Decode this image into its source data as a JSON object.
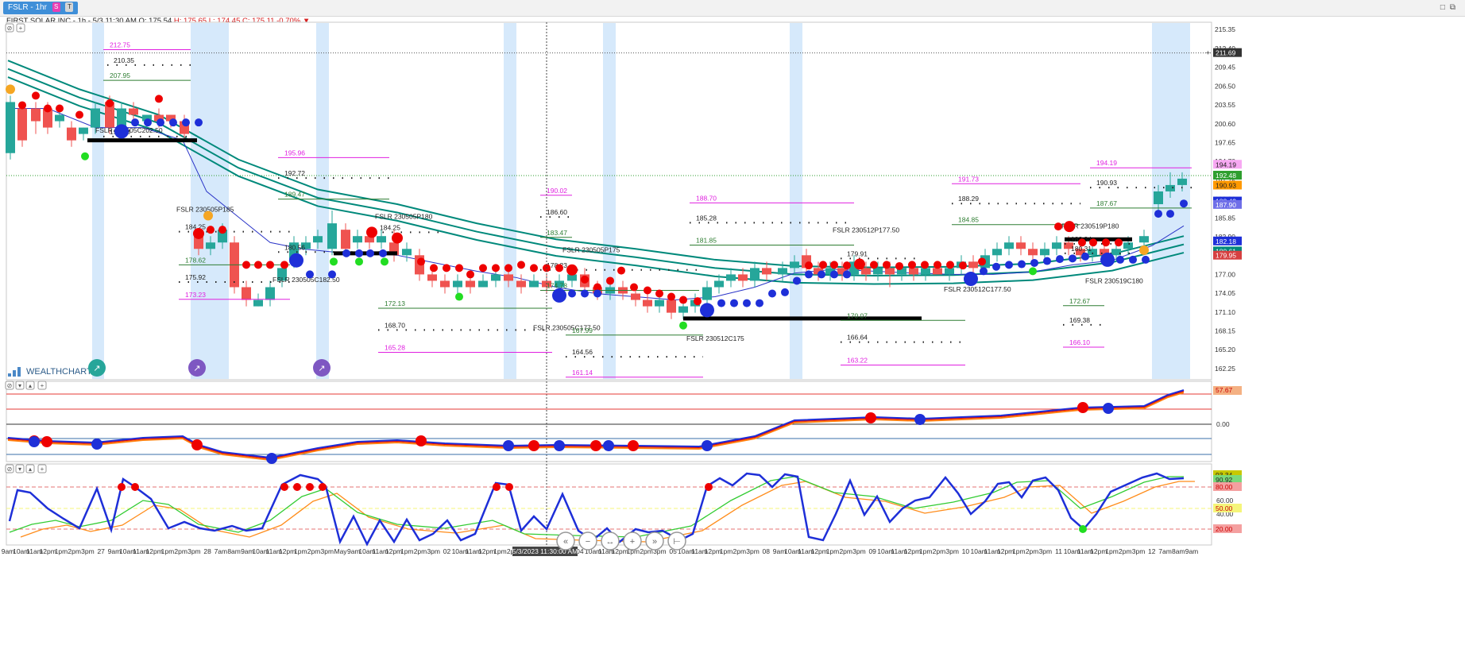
{
  "tab": {
    "label": "FSLR - 1hr",
    "badge_s": "S",
    "badge_t": "T"
  },
  "window_icons": [
    "minimize-icon",
    "restore-icon"
  ],
  "info": {
    "company": "FIRST SOLAR INC",
    "interval": "- 1h -",
    "datetime": "5/3 11:30 AM",
    "open": "O: 175.54",
    "high": "H: 175.65",
    "low": "L: 174.45",
    "close": "C: 175.11",
    "change": "-0.70%"
  },
  "logo": "WEALTHCHARTS",
  "crosshair_time": "5/3/2023 11:30:00 AM",
  "nav_buttons": [
    "«",
    "−",
    "↔",
    "+",
    "»",
    "⊢"
  ],
  "colors": {
    "up": "#26a69a",
    "down": "#ef5350",
    "band": "#00897b",
    "highlight": "#d6e9fb",
    "signal_red": "#ee0000",
    "signal_blue": "#1e2fd8",
    "magenta": "#e020e0",
    "green_line": "#2e7d32"
  },
  "chart_data": [
    {
      "type": "candlestick",
      "title": "FIRST SOLAR INC - 1h",
      "y_ticks": [
        "215.35",
        "212.40",
        "209.45",
        "206.50",
        "203.55",
        "200.60",
        "197.65",
        "194.70",
        "191.75",
        "188.80",
        "185.85",
        "182.90",
        "179.95",
        "177.00",
        "174.05",
        "171.10",
        "168.15",
        "165.20",
        "162.25"
      ],
      "price_labels": [
        "211.69",
        "194.19",
        "192.48",
        "190.93",
        "188.43",
        "187.90",
        "182.18",
        "180.61",
        "179.95"
      ],
      "x_labels": [
        "9am",
        "10am",
        "11am",
        "12pm",
        "1pm",
        "2pm",
        "3pm",
        "27",
        "9am",
        "10am",
        "11am",
        "12pm",
        "1pm",
        "2pm",
        "3pm",
        "28",
        "7am",
        "8am",
        "9am",
        "10am",
        "11am",
        "12pm",
        "1pm",
        "2pm",
        "3pm",
        "May",
        "9am",
        "10am",
        "11am",
        "12pm",
        "1pm",
        "2pm",
        "3pm",
        "02",
        "10am",
        "11am",
        "12pm",
        "1pm",
        "2pm",
        "3pm",
        "03",
        "8am",
        "9am",
        "04",
        "10am",
        "11am",
        "12pm",
        "1pm",
        "2pm",
        "3pm",
        "05",
        "10am",
        "11am",
        "12pm",
        "1pm",
        "2pm",
        "3pm",
        "08",
        "9am",
        "10am",
        "11am",
        "12pm",
        "1pm",
        "2pm",
        "3pm",
        "09",
        "10am",
        "11am",
        "12pm",
        "1pm",
        "2pm",
        "3pm",
        "10",
        "10am",
        "11am",
        "12pm",
        "1pm",
        "2pm",
        "3pm",
        "11",
        "10am",
        "11am",
        "12pm",
        "1pm",
        "2pm",
        "3pm",
        "12",
        "7am",
        "8am",
        "9am"
      ],
      "annotations": [
        "212.75",
        "210.35",
        "207.95",
        "FSLR 230505C202.50",
        "198.63",
        "FSLR 230505P185",
        "184.25",
        "178.62",
        "175.92",
        "173.23",
        "180.56",
        "FSLR 230505C182.50",
        "195.96",
        "192.72",
        "189.47",
        "FSLR 230505P180",
        "184.25",
        "190.02",
        "186.60",
        "183.47",
        "FSLR 230505P175",
        "178.23",
        "174.78",
        "172.13",
        "168.70",
        "165.28",
        "FSLR 230505C177.50",
        "167.99",
        "164.56",
        "161.14",
        "188.70",
        "185.28",
        "181.85",
        "FSLR 230512C175",
        "FSLR 230512P177.50",
        "179.91",
        "170.07",
        "166.64",
        "163.22",
        "191.73",
        "188.29",
        "184.85",
        "FSLR 230512C177.50",
        "194.19",
        "190.93",
        "187.67",
        "FSLR 230519P180",
        "182.34",
        "180.31",
        "172.67",
        "169.38",
        "166.10",
        "FSLR 230519C180"
      ]
    },
    {
      "type": "line",
      "title": "",
      "y_ticks": [
        "0.00"
      ],
      "price_labels": [
        "57.67"
      ]
    },
    {
      "type": "line",
      "title": "",
      "y_ticks": [
        "60.00",
        "40.00"
      ],
      "price_labels": [
        "93.34",
        "90.92",
        "80.00",
        "50.00",
        "20.00"
      ]
    }
  ]
}
